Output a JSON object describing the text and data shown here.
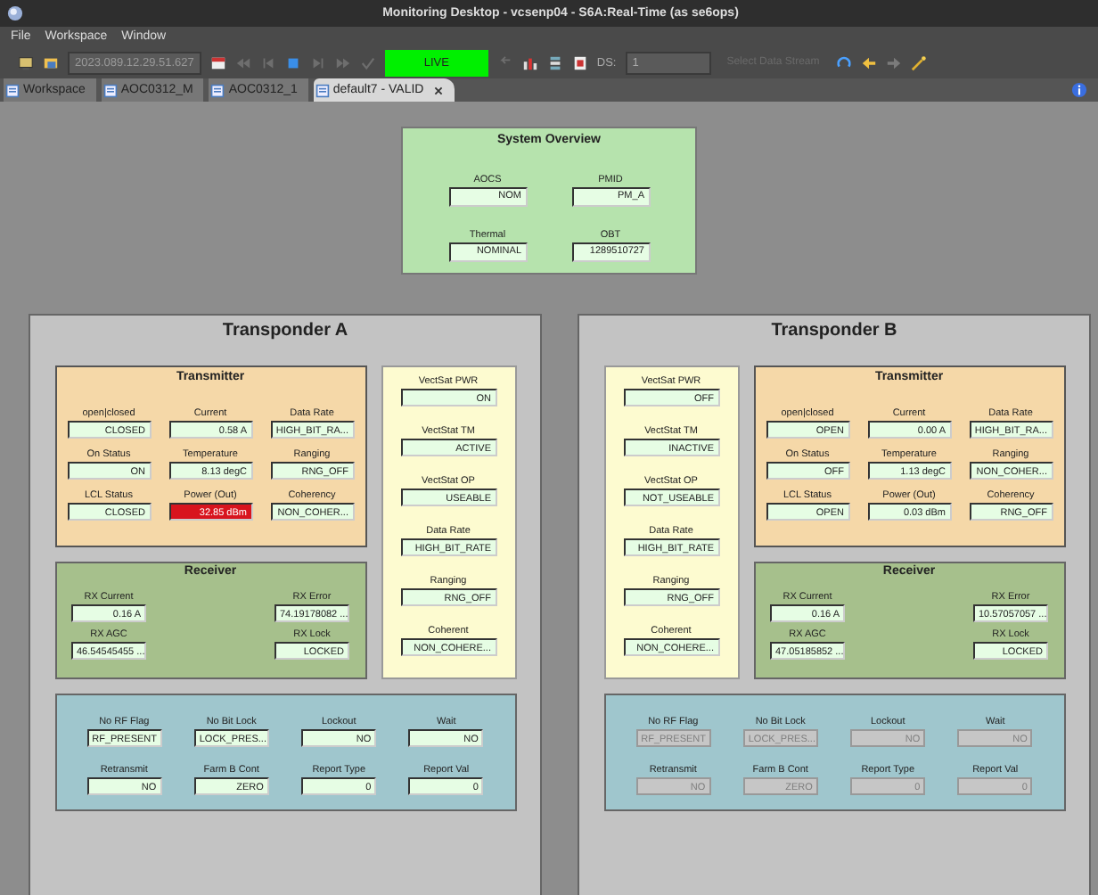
{
  "window": {
    "title": "Monitoring Desktop - vcsenp04 - S6A:Real-Time  (as se6ops)"
  },
  "menu": [
    "File",
    "Workspace",
    "Window"
  ],
  "toolbar": {
    "time": "2023.089.12.29.51.627",
    "live": "LIVE",
    "ds_label": "DS:",
    "ds_value": "1",
    "select_button": "Select Data Stream"
  },
  "tabs": [
    {
      "label": "Workspace",
      "selected": false
    },
    {
      "label": "AOC0312_M",
      "selected": false
    },
    {
      "label": "AOC0312_1",
      "selected": false
    },
    {
      "label": "default7 - VALID",
      "selected": true
    }
  ],
  "overview": {
    "title": "System Overview",
    "fields": [
      {
        "label": "AOCS",
        "value": "NOM"
      },
      {
        "label": "PMID",
        "value": "PM_A"
      },
      {
        "label": "Thermal",
        "value": "NOMINAL"
      },
      {
        "label": "OBT",
        "value": "1289510727"
      }
    ]
  },
  "transponders": [
    {
      "title": "Transponder A",
      "mirrored": false,
      "transmitter": {
        "title": "Transmitter",
        "fields": [
          {
            "label": "open|closed",
            "value": "CLOSED",
            "alarm": false
          },
          {
            "label": "Current",
            "value": "0.58 A",
            "alarm": false
          },
          {
            "label": "Data Rate",
            "value": "HIGH_BIT_RA...",
            "alarm": false
          },
          {
            "label": "On Status",
            "value": "ON",
            "alarm": false
          },
          {
            "label": "Temperature",
            "value": "8.13 degC",
            "alarm": false
          },
          {
            "label": "Ranging",
            "value": "RNG_OFF",
            "alarm": false
          },
          {
            "label": "LCL Status",
            "value": "CLOSED",
            "alarm": false
          },
          {
            "label": "Power (Out)",
            "value": "32.85 dBm",
            "alarm": true
          },
          {
            "label": "Coherency",
            "value": "NON_COHER...",
            "alarm": false
          }
        ]
      },
      "receiver": {
        "title": "Receiver",
        "fields": [
          {
            "label": "RX Current",
            "value": "0.16 A"
          },
          {
            "label": "RX Error",
            "value": "74.19178082 ..."
          },
          {
            "label": "RX AGC",
            "value": "46.54545455 ..."
          },
          {
            "label": "RX Lock",
            "value": "LOCKED"
          }
        ]
      },
      "status": {
        "fields": [
          {
            "label": "VectSat PWR",
            "value": "ON"
          },
          {
            "label": "VectStat TM",
            "value": "ACTIVE"
          },
          {
            "label": "VectStat OP",
            "value": "USEABLE"
          },
          {
            "label": "Data Rate",
            "value": "HIGH_BIT_RATE"
          },
          {
            "label": "Ranging",
            "value": "RNG_OFF"
          },
          {
            "label": "Coherent",
            "value": "NON_COHERE..."
          }
        ]
      },
      "flags": {
        "fields": [
          {
            "label": "No RF Flag",
            "value": "RF_PRESENT",
            "disabled": false
          },
          {
            "label": "No Bit Lock",
            "value": "LOCK_PRES...",
            "disabled": false
          },
          {
            "label": "Lockout",
            "value": "NO",
            "disabled": false
          },
          {
            "label": "Wait",
            "value": "NO",
            "disabled": false
          },
          {
            "label": "Retransmit",
            "value": "NO",
            "disabled": false
          },
          {
            "label": "Farm B Cont",
            "value": "ZERO",
            "disabled": false
          },
          {
            "label": "Report Type",
            "value": "0",
            "disabled": false
          },
          {
            "label": "Report Val",
            "value": "0",
            "disabled": false
          }
        ]
      }
    },
    {
      "title": "Transponder B",
      "mirrored": true,
      "transmitter": {
        "title": "Transmitter",
        "fields": [
          {
            "label": "open|closed",
            "value": "OPEN",
            "alarm": false
          },
          {
            "label": "Current",
            "value": "0.00 A",
            "alarm": false
          },
          {
            "label": "Data Rate",
            "value": "HIGH_BIT_RA...",
            "alarm": false
          },
          {
            "label": "On Status",
            "value": "OFF",
            "alarm": false
          },
          {
            "label": "Temperature",
            "value": "1.13 degC",
            "alarm": false
          },
          {
            "label": "Ranging",
            "value": "NON_COHER...",
            "alarm": false
          },
          {
            "label": "LCL Status",
            "value": "OPEN",
            "alarm": false
          },
          {
            "label": "Power (Out)",
            "value": "0.03 dBm",
            "alarm": false
          },
          {
            "label": "Coherency",
            "value": "RNG_OFF",
            "alarm": false
          }
        ]
      },
      "receiver": {
        "title": "Receiver",
        "fields": [
          {
            "label": "RX Current",
            "value": "0.16 A"
          },
          {
            "label": "RX Error",
            "value": "10.57057057 ..."
          },
          {
            "label": "RX AGC",
            "value": "47.05185852 ..."
          },
          {
            "label": "RX Lock",
            "value": "LOCKED"
          }
        ]
      },
      "status": {
        "fields": [
          {
            "label": "VectSat PWR",
            "value": "OFF"
          },
          {
            "label": "VectStat TM",
            "value": "INACTIVE"
          },
          {
            "label": "VectStat OP",
            "value": "NOT_USEABLE"
          },
          {
            "label": "Data Rate",
            "value": "HIGH_BIT_RATE"
          },
          {
            "label": "Ranging",
            "value": "RNG_OFF"
          },
          {
            "label": "Coherent",
            "value": "NON_COHERE..."
          }
        ]
      },
      "flags": {
        "fields": [
          {
            "label": "No RF Flag",
            "value": "RF_PRESENT",
            "disabled": true
          },
          {
            "label": "No Bit Lock",
            "value": "LOCK_PRES...",
            "disabled": true
          },
          {
            "label": "Lockout",
            "value": "NO",
            "disabled": true
          },
          {
            "label": "Wait",
            "value": "NO",
            "disabled": true
          },
          {
            "label": "Retransmit",
            "value": "NO",
            "disabled": true
          },
          {
            "label": "Farm B Cont",
            "value": "ZERO",
            "disabled": true
          },
          {
            "label": "Report Type",
            "value": "0",
            "disabled": true
          },
          {
            "label": "Report Val",
            "value": "0",
            "disabled": true
          }
        ]
      }
    }
  ]
}
